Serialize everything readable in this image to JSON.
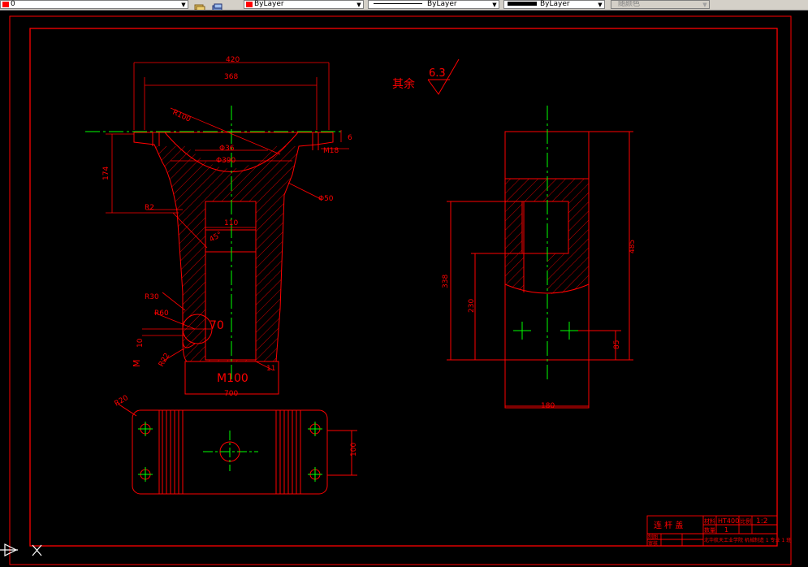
{
  "toolbar": {
    "layer_value": "0",
    "color_value": "ByLayer",
    "linetype_value": "ByLayer",
    "lineweight_value": "ByLayer",
    "plotstyle_value": "随颜色"
  },
  "colors": {
    "drawing": "#ff0000",
    "centerline": "#00ff00",
    "text": "#ff0000",
    "white": "#ffffff"
  },
  "drawing": {
    "roughness_label": "其余",
    "roughness_value": "6.3",
    "dims": {
      "w420": "420",
      "w368": "368",
      "r100": "R100",
      "m18": "M18",
      "d6": "6",
      "phi36": "Φ36",
      "phi390": "Φ390",
      "phi50": "Φ50",
      "h174": "174",
      "r2": "R2",
      "d45": "45°",
      "w110": "110",
      "r30": "R30",
      "r60": "R60",
      "d70": "70",
      "d10": "10",
      "m": "M",
      "r22": "R22",
      "m100": "M100",
      "d11": "11",
      "w700": "700",
      "r20": "R20",
      "d100": "100",
      "h485": "485",
      "h338": "338",
      "h230": "230",
      "d85": "85",
      "w180": "180"
    },
    "title_block": {
      "name": "连 杆 盖",
      "material_label": "材料",
      "material": "HT400",
      "scale_label": "比例",
      "scale": "1:2",
      "count_label": "数量",
      "count": "1",
      "drawn_label": "制图",
      "checked_label": "审核",
      "school": "北华航天工业学院 机械制造 1 专业 1 班"
    }
  }
}
